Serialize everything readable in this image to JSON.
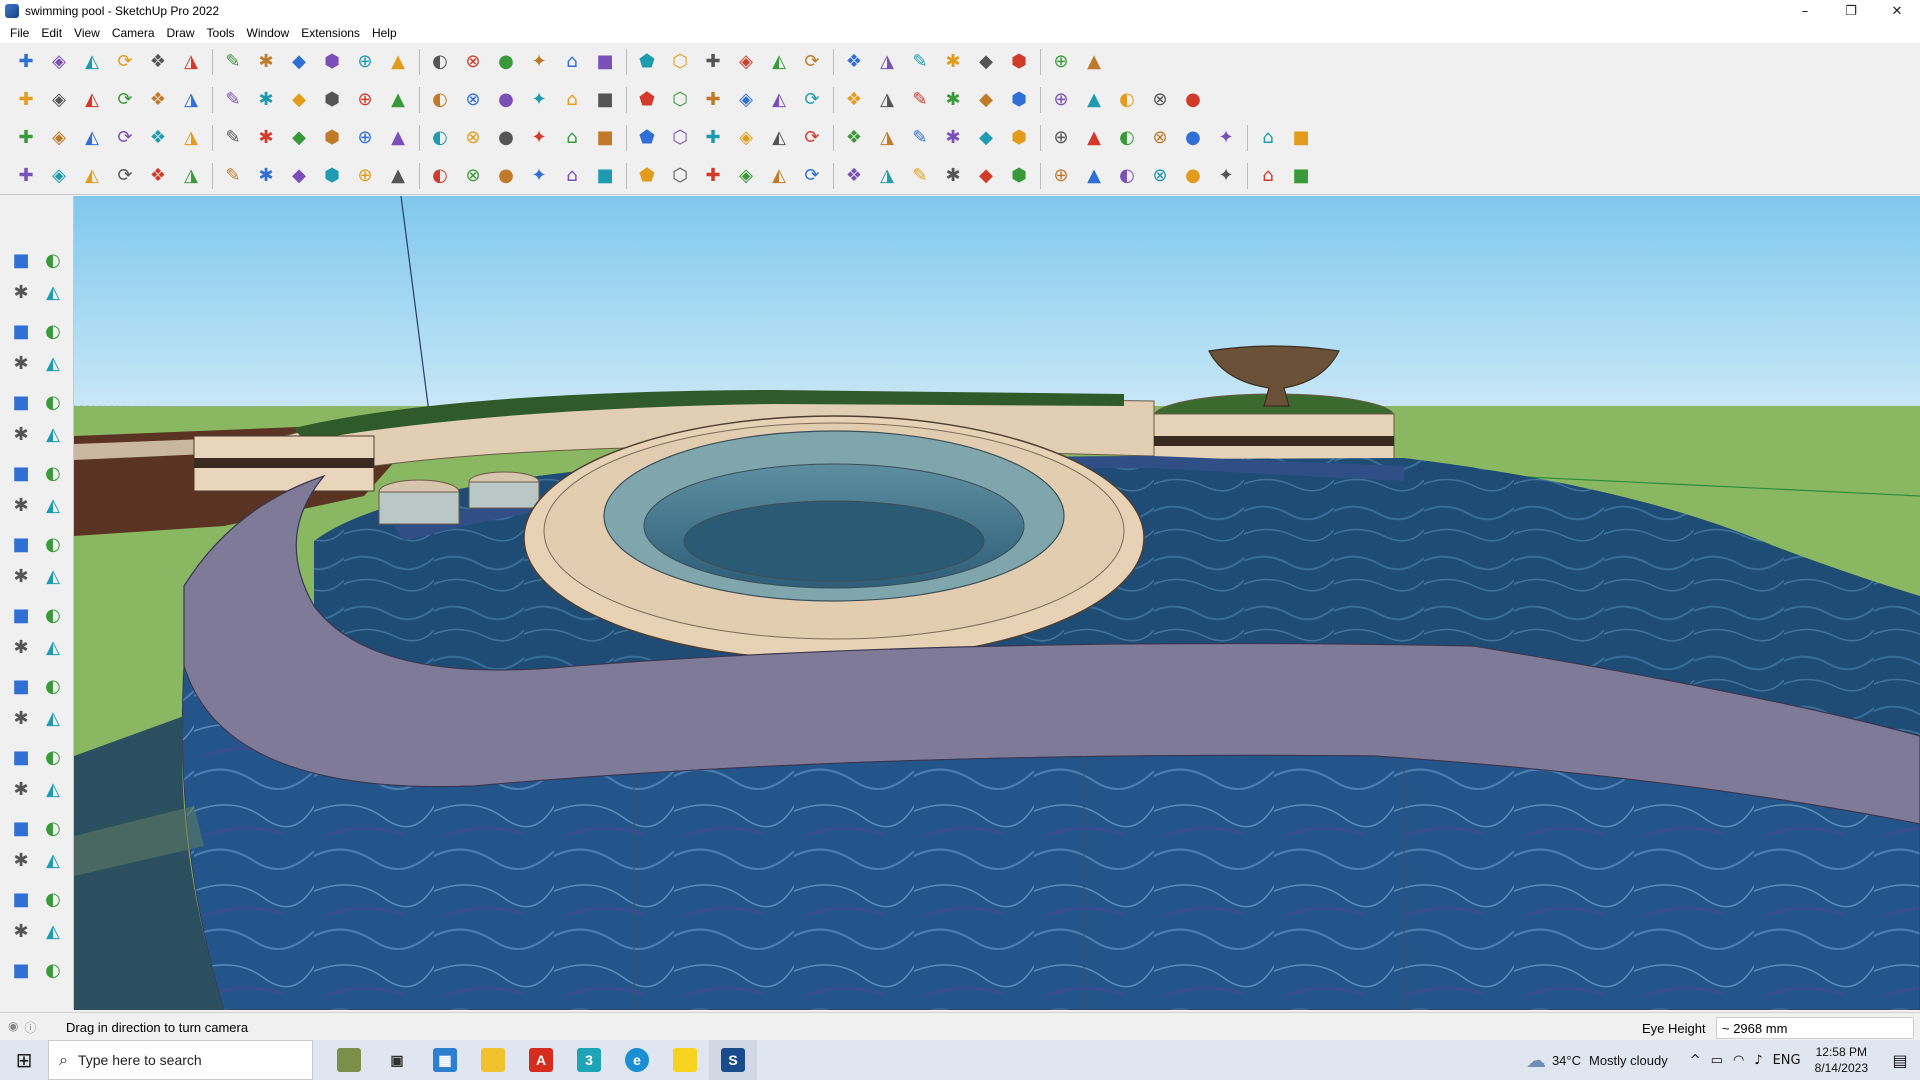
{
  "window": {
    "title": "swimming pool - SketchUp Pro 2022",
    "minimize": "–",
    "restore": "❐",
    "close": "✕"
  },
  "menu": [
    "File",
    "Edit",
    "View",
    "Camera",
    "Draw",
    "Tools",
    "Window",
    "Extensions",
    "Help"
  ],
  "toolbar_row1_icons": [
    "search-icon",
    "select-arrow-icon",
    "eraser-icon",
    "pencil-line-icon",
    "freehand-icon",
    "rectangle-icon",
    "push-pull-icon",
    "follow-me-icon",
    "move-icon",
    "rotate-icon",
    "scale-icon",
    "tape-measure-icon",
    "text-icon",
    "paint-bucket-icon",
    "orbit-icon",
    "pan-icon",
    "zoom-icon",
    "zoom-extents-icon",
    "section-plane-icon",
    "layers-icon",
    "tags-icon",
    "components-icon",
    "account-icon",
    "flip-icon",
    "mirror-icon",
    "align-icon",
    "arrows-up-icon",
    "arrows-down-icon",
    "resize-icon",
    "undo-icon",
    "redo-icon",
    "extension-icon"
  ],
  "toolbar_row2_icons": [
    "iso-view-icon",
    "top-view-icon",
    "front-view-icon",
    "push-icon",
    "solid-union-icon",
    "solid-subtract-icon",
    "solid-trim-icon",
    "solid-intersect-icon",
    "solid-split-icon",
    "shell-icon",
    "outer-shell-icon",
    "section-fill-icon",
    "slice-icon",
    "sandbox-icon",
    "smoove-icon",
    "house-icon",
    "roof-icon",
    "home-icon",
    "warehouse-icon",
    "fx-icon",
    "curve-icon",
    "ruler-icon",
    "spline-icon",
    "circle-icon",
    "polygon-icon",
    "ellipse-icon",
    "parallelogram-icon",
    "arc-icon",
    "helix-icon",
    "bezier-icon",
    "loft-icon",
    "extrude-icon",
    "texture-icon",
    "material-icon",
    "terrain-icon"
  ],
  "toolbar_row3_icons": [
    "face-icon",
    "plane-icon",
    "square-icon",
    "component-tag-icon",
    "cube-red-icon",
    "layer-stack-icon",
    "round-corner-icon",
    "red-box-icon",
    "hatch-icon",
    "panel-icon",
    "wood-icon",
    "chain-icon",
    "fillet-icon",
    "spline-draw-icon",
    "cross-red-icon",
    "cross-green-icon",
    "cross-blue-icon",
    "cone-icon",
    "cone-alt-icon",
    "pyramid-icon",
    "loop-icon",
    "knot-icon",
    "refresh-icon",
    "star-icon",
    "bucket-icon",
    "magnet-icon",
    "extrude-multi-icon",
    "cube-group-icon",
    "cube-set-icon",
    "cube-stack-icon",
    "gear-red-icon",
    "frame-icon",
    "window-icon",
    "grid-orange-icon",
    "grid-orange-alt-icon",
    "scatter-icon",
    "dotted-circle-icon",
    "grid-small-icon"
  ],
  "toolbar_row4_icons": [
    "curve-tool-icon",
    "spline-tool-icon",
    "red-car-icon",
    "eraser-rot-icon",
    "brush-icon",
    "pipe-icon",
    "cube-iso-icon",
    "lathe-icon",
    "sweep-icon",
    "corner-icon",
    "corner-alt-icon",
    "line-red-icon",
    "bend-icon",
    "frame-round-icon",
    "sail-icon",
    "column-icon",
    "pillar-icon",
    "hand-icon",
    "leaf-icon",
    "ribbon-icon",
    "stair-icon",
    "slab-icon",
    "wing-icon",
    "wing-alt-icon",
    "wing-flat-icon",
    "car-icon",
    "stack-icon",
    "wall-icon",
    "wall-alt-icon",
    "fence-icon",
    "hatch-dense-icon",
    "ladder-icon",
    "comb-icon",
    "shell-round-icon",
    "fan-icon",
    "spring-icon",
    "coil-icon",
    "diamond-icon"
  ],
  "left_tools": [
    "select-icon",
    "orbit-icon",
    "paint-icon",
    "eraser-icon",
    "component-icon",
    "tape-icon",
    "pencil-icon",
    "freehand-icon",
    "rectangle-icon",
    "rotated-rect-icon",
    "circle-icon",
    "polygon-icon",
    "arc-icon",
    "arc-2pt-icon",
    "arc-3pt-icon",
    "pie-icon",
    "move-icon",
    "push-pull-icon",
    "rotate-icon",
    "follow-me-icon",
    "scale-icon",
    "offset-icon",
    "tape-measure-icon",
    "dimension-icon",
    "protractor-icon",
    "text-icon",
    "axes-icon",
    "3d-text-icon",
    "orbit-tool-icon",
    "pan-icon",
    "zoom-icon",
    "zoom-window-icon",
    "zoom-extents-icon",
    "previous-icon",
    "position-camera-icon",
    "look-around-icon",
    "walk-icon",
    "section-icon",
    "section-plane-icon",
    "section-cut-icon",
    "tags-icon",
    "styles-icon"
  ],
  "status": {
    "message": "Drag in direction to turn camera",
    "measure_label": "Eye Height",
    "measure_value": "~ 2968 mm"
  },
  "taskbar": {
    "search_placeholder": "Type here to search",
    "weather_temp": "34°C",
    "weather_text": "Mostly cloudy",
    "lang": "ENG",
    "time": "12:58 PM",
    "date": "8/14/2023"
  },
  "colors": {
    "sky_top": "#87cdf0",
    "sky_bottom": "#c6e6f5",
    "ground": "#8db866",
    "water": "#1f4f7a",
    "coping": "#e8d3b8",
    "deck": "#7e7a96",
    "tile": "#2c5f8f"
  }
}
